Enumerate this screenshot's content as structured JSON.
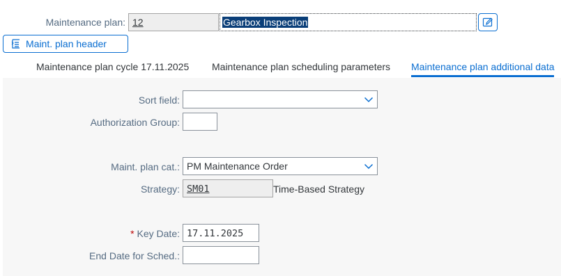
{
  "header": {
    "plan_label": "Maintenance plan:",
    "plan_number": "12",
    "plan_description": "Gearbox Inspection"
  },
  "toolbar": {
    "header_button_label": "Maint. plan header",
    "header_button_icon": "header-doc-icon",
    "edit_icon": "edit-text-icon"
  },
  "tabs": [
    {
      "label": "Maintenance plan cycle 17.11.2025",
      "active": false
    },
    {
      "label": "Maintenance plan scheduling parameters",
      "active": false
    },
    {
      "label": "Maintenance plan additional data",
      "active": true
    }
  ],
  "form": {
    "sort_field": {
      "label": "Sort field:",
      "value": ""
    },
    "authorization_group": {
      "label": "Authorization Group:",
      "value": ""
    },
    "plan_category": {
      "label": "Maint. plan cat.:",
      "value": "PM Maintenance Order"
    },
    "strategy": {
      "label": "Strategy:",
      "value": "SM01",
      "description": "Time-Based Strategy"
    },
    "key_date": {
      "label": "Key Date:",
      "required_marker": "*",
      "value": "17.11.2025"
    },
    "end_date": {
      "label": "End Date for Sched.:",
      "value": ""
    }
  },
  "colors": {
    "accent": "#0a6ed1",
    "selection": "#0a3e78",
    "required": "#bb0000"
  }
}
